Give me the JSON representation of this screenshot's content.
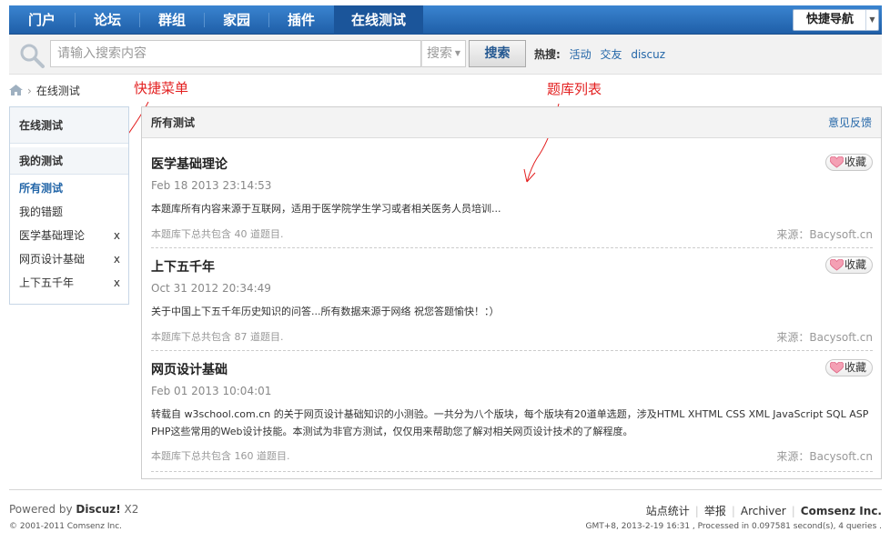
{
  "nav": {
    "items": [
      "门户",
      "论坛",
      "群组",
      "家园",
      "插件",
      "在线测试"
    ],
    "active_index": 5,
    "quick_nav": "快捷导航"
  },
  "search": {
    "placeholder": "请输入搜索内容",
    "type": "搜索",
    "button": "搜索",
    "hot_label": "热搜:",
    "hot_links": [
      "活动",
      "交友",
      "discuz"
    ]
  },
  "breadcrumb": {
    "current": "在线测试"
  },
  "annotations": {
    "quick_menu": "快捷菜单",
    "quiz_list": "题库列表"
  },
  "sidebar": {
    "title": "在线测试",
    "section": "我的测试",
    "items": [
      {
        "label": "所有测试",
        "selected": true,
        "removable": false
      },
      {
        "label": "我的错题",
        "selected": false,
        "removable": false
      },
      {
        "label": "医学基础理论",
        "selected": false,
        "removable": true
      },
      {
        "label": "网页设计基础",
        "selected": false,
        "removable": true
      },
      {
        "label": "上下五千年",
        "selected": false,
        "removable": true
      }
    ],
    "remove_glyph": "x"
  },
  "main": {
    "title": "所有测试",
    "feedback": "意见反馈",
    "fav_label": "收藏",
    "quizzes": [
      {
        "title": "医学基础理论",
        "date": "Feb 18 2013 23:14:53",
        "desc": "本题库所有内容来源于互联网，适用于医学院学生学习或者相关医务人员培训...",
        "count": "本题库下总共包含 40 道题目.",
        "source": "来源：Bacysoft.cn"
      },
      {
        "title": "上下五千年",
        "date": "Oct 31 2012 20:34:49",
        "desc": "关于中国上下五千年历史知识的问答...所有数据来源于网络 祝您答题愉快！：）",
        "count": "本题库下总共包含 87 道题目.",
        "source": "来源：Bacysoft.cn"
      },
      {
        "title": "网页设计基础",
        "date": "Feb 01 2013 10:04:01",
        "desc": "转载自 w3school.com.cn 的关于网页设计基础知识的小测验。一共分为八个版块，每个版块有20道单选题，涉及HTML XHTML CSS XML JavaScript SQL ASP PHP这些常用的Web设计技能。本测试为非官方测试，仅仅用来帮助您了解对相关网页设计技术的了解程度。",
        "count": "本题库下总共包含 160 道题目.",
        "source": "来源：Bacysoft.cn"
      }
    ]
  },
  "footer": {
    "powered_prefix": "Powered by ",
    "powered_brand": "Discuz!",
    "powered_version": " X2",
    "copyright": "© 2001-2011 Comsenz Inc.",
    "links": [
      "站点统计",
      "举报",
      "Archiver",
      "Comsenz Inc."
    ],
    "gmt": "GMT+8, 2013-2-19 16:31 , Processed in 0.097581 second(s), 4 queries ."
  },
  "colors": {
    "nav_bg": "#2b6eb8",
    "link": "#2366a8",
    "annotation": "#e32020"
  }
}
